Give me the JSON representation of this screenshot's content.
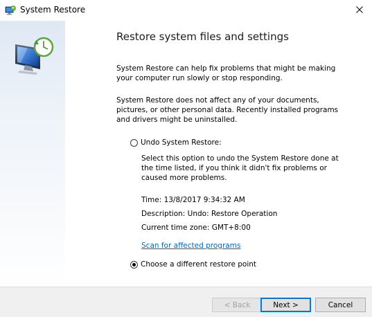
{
  "window": {
    "title": "System Restore",
    "icon": "system-restore-icon",
    "close_icon": "close-icon"
  },
  "sidebar": {
    "icon": "system-restore-monitor-icon"
  },
  "main": {
    "heading": "Restore system files and settings",
    "paragraph1": "System Restore can help fix problems that might be making your computer run slowly or stop responding.",
    "paragraph2": "System Restore does not affect any of your documents, pictures, or other personal data. Recently installed programs and drivers might be uninstalled.",
    "undo_option": {
      "label": "Undo System Restore:",
      "checked": false,
      "description": "Select this option to undo the System Restore done at the time listed, if you think it didn't fix problems or caused more problems.",
      "time": "Time: 13/8/2017 9:34:32 AM",
      "description_line": "Description: Undo: Restore Operation",
      "timezone": "Current time zone: GMT+8:00",
      "scan_link": "Scan for affected programs"
    },
    "choose_option": {
      "label": "Choose a different restore point",
      "checked": true
    }
  },
  "footer": {
    "back_label": "< Back",
    "next_label": "Next >",
    "cancel_label": "Cancel"
  },
  "colors": {
    "link": "#0066cc",
    "accent": "#0078d7",
    "sidebar_top": "#dfe8f4"
  }
}
